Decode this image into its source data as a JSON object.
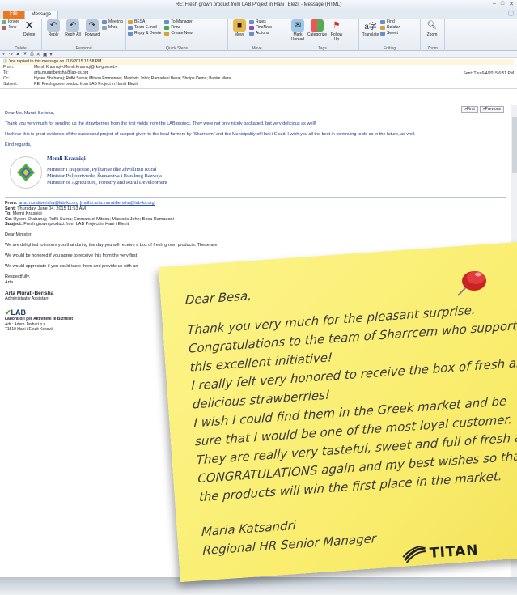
{
  "window": {
    "title": "RE: Fresh grown product from LAB Project in Hani i Elezit - Message (HTML)"
  },
  "tabs": {
    "file": "File",
    "message": "Message"
  },
  "ribbon": {
    "delete": {
      "ignore": "Ignore",
      "junk": "Junk",
      "delete": "Delete",
      "label": "Delete"
    },
    "respond": {
      "reply": "Reply",
      "reply_all": "Reply All",
      "forward": "Forward",
      "meeting": "Meeting",
      "more": "More",
      "label": "Respond"
    },
    "quicksteps": {
      "besa": "BESA",
      "team_email": "Team E-mail",
      "reply_delete": "Reply & Delete",
      "to_manager": "To Manager",
      "done": "Done",
      "create_new": "Create New",
      "label": "Quick Steps"
    },
    "move": {
      "move": "Move",
      "rules": "Rules",
      "onenote": "OneNote",
      "actions": "Actions",
      "label": "Move"
    },
    "tags": {
      "mark_unread": "Mark Unread",
      "categorize": "Categorize",
      "follow_up": "Follow Up",
      "label": "Tags"
    },
    "editing": {
      "translate": "Translate",
      "find": "Find",
      "related": "Related",
      "select": "Select",
      "label": "Editing"
    },
    "zoom": {
      "zoom": "Zoom",
      "label": "Zoom"
    }
  },
  "header": {
    "info": "You replied to this message on 11/6/2015 12:58 PM.",
    "from_label": "From:",
    "from": "Memli Krasniqi <Memli.Krasniqi@rks-gov.net>",
    "to_label": "To:",
    "to": "arta.muratiberisha@lab-ks.org",
    "cc_label": "Cc:",
    "cc": "Hysen Shabanaj; Rufki Suma; Mitsou Emmanuel; Mastoris John; Ramadani Besa; Shqipe Dema; Bunim Meraj",
    "subject_label": "Subject:",
    "subject": "RE: Fresh grown product from LAB Project in Hani i Elezit",
    "sent": "Sent:  Thu 6/4/2015 6:51 PM"
  },
  "nav": {
    "first": "»First",
    "previous": "«Previous"
  },
  "body": {
    "greeting": "Dear Ms. Murati-Berisha,",
    "p1": "Thank you very much for sending us the strawberries from the first yields from the LAB project. They were not only nicely packaged, but very delicious as well!",
    "p2": "I believe this is great evidence of the successful project of support given to the local farmers by “Sharrcem” and the Municipality of Hani i Elezit. I wish you all the best in continuing to do so in the future, as well.",
    "regards": "Kind regards,",
    "sig_name": "Memli Krasniqi",
    "sig_l1": "Minister i Bujqësisë, Pylltarisë dhe Zhvillimit Rural",
    "sig_l2": "Ministar Poljoprivrede, Šumarstva i Ruralnog Razvoja",
    "sig_l3": "Minister of Agriculture, Forestry and Rural Development"
  },
  "quoted": {
    "from_label": "From:",
    "from": "arta.muratiberisha@lab-ks.org",
    "mailto": "[mailto:arta.muratiberisha@lab-ks.org]",
    "sent_label": "Sent:",
    "sent": "Thursday, June 04, 2015 11:53 AM",
    "to_label": "To:",
    "to": "Memli Krasniqi",
    "cc_label": "Cc:",
    "cc": "Hysen Shabanaj; Rufki Suma; Emmanuel Mitsou; Mastoris John; Besa Ramadani",
    "subject_label": "Subject:",
    "subject": "Fresh grown product from LAB Project in Hani i Elezit",
    "greeting": "Dear Minister,",
    "p1": "We are delighted to inform you that during the day you will receive a box of fresh grown products. These are ",
    "p2": "We would be honored if you agree to receive this from the very first",
    "p3": "We would appreciate if you could taste them and provide us with an",
    "respect": "Respectfully,",
    "arta": "Arta",
    "name": "Arta Murati-Berisha",
    "title": "Administrativ Assistant",
    "dashes": "---------------------------------",
    "lab": "LAB",
    "lab_full": "Laboratori për Aktivitete të Biznesit",
    "addr1": "Adr.: Adem Jashari p.n",
    "addr2": "71510 Hani i Elezit Kosovë"
  },
  "note": {
    "greeting": "Dear Besa,",
    "lines": [
      "Thank you very much for the pleasant surprise.",
      "Congratulations to the team of Sharrcem who support",
      "this excellent initiative!",
      "I really felt very honored to receive the box of fresh and",
      "delicious strawberries!",
      "I wish I could find them in the Greek market and be",
      "sure that I would be one of the most loyal customer.",
      "They are really very tasteful, sweet and full of fresh aroma.",
      "CONGRATULATIONS again and my best wishes so that",
      "the products will win the first place in the market."
    ],
    "author": "Maria Katsandri",
    "role": "Regional HR Senior Manager",
    "brand": "TITAN"
  },
  "colors": {
    "file_tab": "#e97a23",
    "note": "#fbef78",
    "pin": "#d32b2b",
    "link": "#1f50b5"
  }
}
